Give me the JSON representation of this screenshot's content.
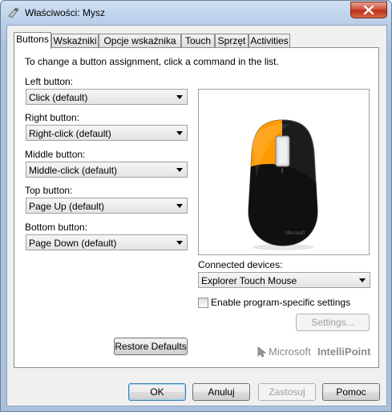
{
  "window": {
    "title": "Właściwości: Mysz"
  },
  "tabs": [
    {
      "label": "Buttons"
    },
    {
      "label": "Wskaźniki"
    },
    {
      "label": "Opcje wskaźnika"
    },
    {
      "label": "Touch"
    },
    {
      "label": "Sprzęt"
    },
    {
      "label": "Activities"
    }
  ],
  "buttons_tab": {
    "instruction": "To change a button assignment, click a command in the list.",
    "left": {
      "label": "Left button:",
      "value": "Click (default)"
    },
    "right": {
      "label": "Right button:",
      "value": "Right-click (default)"
    },
    "middle": {
      "label": "Middle button:",
      "value": "Middle-click (default)"
    },
    "top": {
      "label": "Top button:",
      "value": "Page Up (default)"
    },
    "bottom": {
      "label": "Bottom button:",
      "value": "Page Down (default)"
    },
    "connected_label": "Connected devices:",
    "connected_value": "Explorer Touch Mouse",
    "enable_label": "Enable program-specific settings",
    "enable_checked": false,
    "settings_label": "Settings...",
    "restore_label": "Restore Defaults",
    "brand_prefix": "Microsoft",
    "brand_product": "IntelliPoint",
    "mouse_brand": "Microsoft"
  },
  "footer": {
    "ok": "OK",
    "cancel": "Anuluj",
    "apply": "Zastosuj",
    "help": "Pomoc"
  },
  "colors": {
    "highlight": "#ff9900",
    "mouse_body": "#1c1c1c"
  }
}
